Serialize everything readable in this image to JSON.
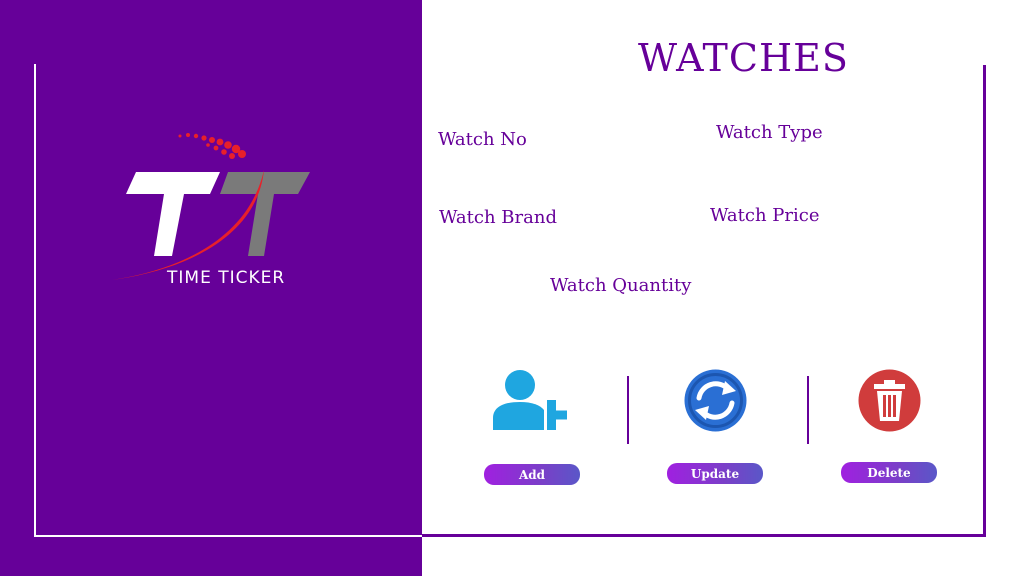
{
  "brand": {
    "logo_text": "TIME TICKER"
  },
  "form": {
    "title": "WATCHES",
    "fields": {
      "watch_no": "Watch No",
      "watch_type": "Watch Type",
      "watch_brand": "Watch Brand",
      "watch_price": "Watch Price",
      "watch_quantity": "Watch Quantity"
    }
  },
  "actions": {
    "add_label": "Add",
    "update_label": "Update",
    "delete_label": "Delete"
  },
  "colors": {
    "brand_purple": "#660099",
    "add_icon": "#1fa6e0",
    "update_icon": "#2a6fd4",
    "delete_icon": "#d03c3c"
  }
}
